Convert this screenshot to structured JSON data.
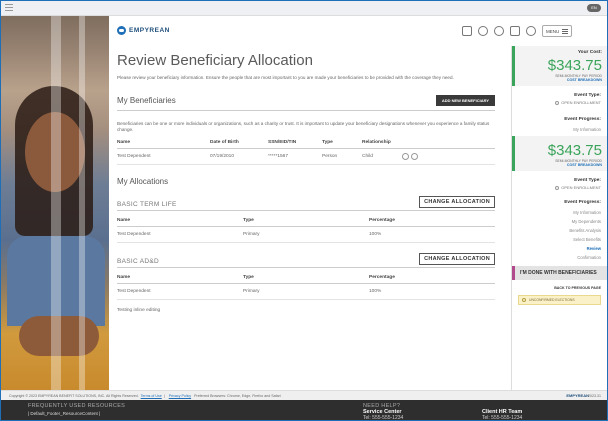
{
  "header": {
    "brand": "EMPYREAN",
    "menu_label": "MENU",
    "pill": "EN"
  },
  "main": {
    "title": "Review Beneficiary Allocation",
    "intro": "Please review your beneficiary information. Ensure the people that are most important to you are made your beneficiaries to be provided with the coverage they need.",
    "beneficiaries": {
      "heading": "My Beneficiaries",
      "add_button": "ADD NEW BENEFICIARY",
      "description": "Beneficiaries can be one or more individuals or organizations, such as a charity or trust. It is important to update your beneficiary designations whenever you experience a family status change.",
      "columns": [
        "Name",
        "Date of Birth",
        "SSN/EID/TIN",
        "Type",
        "Relationship"
      ],
      "rows": [
        {
          "name": "Test Dependent",
          "dob": "07/19/2010",
          "ssn": "*****1567",
          "type": "Person",
          "relationship": "Child"
        }
      ]
    },
    "allocations": {
      "heading": "My Allocations",
      "change_label": "CHANGE ALLOCATION",
      "columns": [
        "Name",
        "Type",
        "Percentage"
      ],
      "groups": [
        {
          "title": "BASIC TERM LIFE",
          "rows": [
            {
              "name": "Test Dependent",
              "type": "Primary",
              "pct": "100%"
            }
          ]
        },
        {
          "title": "BASIC AD&D",
          "rows": [
            {
              "name": "Test Dependent",
              "type": "Primary",
              "pct": "100%"
            }
          ]
        }
      ]
    },
    "note": "Testing inline editing"
  },
  "sidebar": {
    "cost_label": "Your Cost:",
    "cost_value": "$343.75",
    "cost_period": "SEMI-MONTHLY PAY PERIOD",
    "cost_link": "COST BREAKDOWN",
    "event_type_label": "Event Type:",
    "event_type_value": "OPEN ENROLLMENT",
    "event_progress_label": "Event Progress:",
    "progress_items_top": [
      "My Information"
    ],
    "progress_items": [
      "My Information",
      "My Dependents",
      "Benefits Analysis",
      "Select Benefits",
      "Review",
      "Confirmation"
    ],
    "active_item": "Review",
    "done_label": "I'M DONE WITH BENEFICIARIES",
    "back_label": "BACK TO PREVIOUS PAGE",
    "unconfirmed_label": "UNCONFIRMED ELECTIONS"
  },
  "copyright": {
    "text": "Copyright © 2023 EMPYREAN BENEFIT SOLUTIONS, INC. All Rights Reserved.",
    "terms": "Terms of Use",
    "privacy": "Privacy Policy",
    "browsers": "Preferred Browsers: Chrome, Edge, Firefox and Safari",
    "brand": "EMPYREAN",
    "version": "2023.31"
  },
  "footer": {
    "resources_title": "FREQUENTLY USED RESOURCES",
    "resources_body": "| Default_Footer_ResourceContent |",
    "help_title": "NEED HELP?",
    "service_name": "Service Center",
    "service_tel": "Tel: 555-555-1234",
    "hr_name": "Client HR Team",
    "hr_tel": "Tel: 555-555-1234"
  },
  "colors": {
    "accent": "#1e6fb8",
    "cost_green": "#3aa45a",
    "done_magenta": "#b04a8c"
  }
}
